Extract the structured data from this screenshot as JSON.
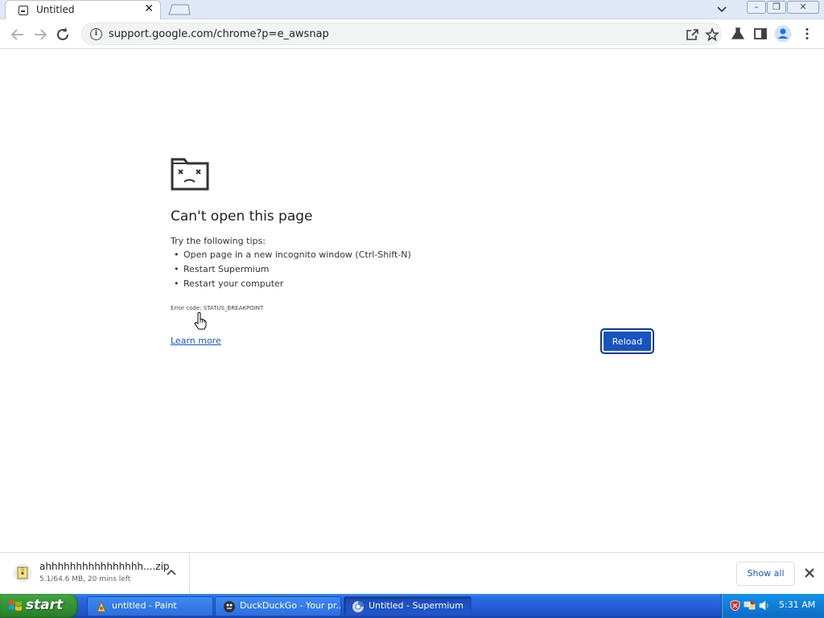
{
  "browser": {
    "tab": {
      "title": "Untitled",
      "close": "✕"
    },
    "address": {
      "url": "support.google.com/chrome?p=e_awsnap",
      "info": "i"
    },
    "window_controls": {
      "minimize": "–",
      "restore": "❐",
      "close": "✕"
    }
  },
  "error_page": {
    "title": "Can't open this page",
    "tips_intro": "Try the following tips:",
    "tips": [
      "Open page in a new incognito window (Ctrl-Shift-N)",
      "Restart Supermium",
      "Restart your computer"
    ],
    "error_code": "Error code: STATUS_BREAKPOINT",
    "learn_more": "Learn more",
    "reload": "Reload"
  },
  "download_shelf": {
    "file_name": "ahhhhhhhhhhhhhhhh....zip",
    "status": "5.1/64.6 MB, 20 mins left",
    "show_all": "Show all"
  },
  "taskbar": {
    "start_label": "start",
    "items": [
      {
        "label": "untitled - Paint",
        "icon": "paint-icon"
      },
      {
        "label": "DuckDuckGo - Your pr...",
        "icon": "duckduckgo-icon"
      },
      {
        "label": "Untitled - Supermium",
        "icon": "supermium-icon"
      }
    ],
    "clock": "5:31 AM"
  },
  "colors": {
    "accent": "#1753c1",
    "link": "#1a55c0",
    "taskbar": "#245edb",
    "start": "#3c9c3c"
  }
}
